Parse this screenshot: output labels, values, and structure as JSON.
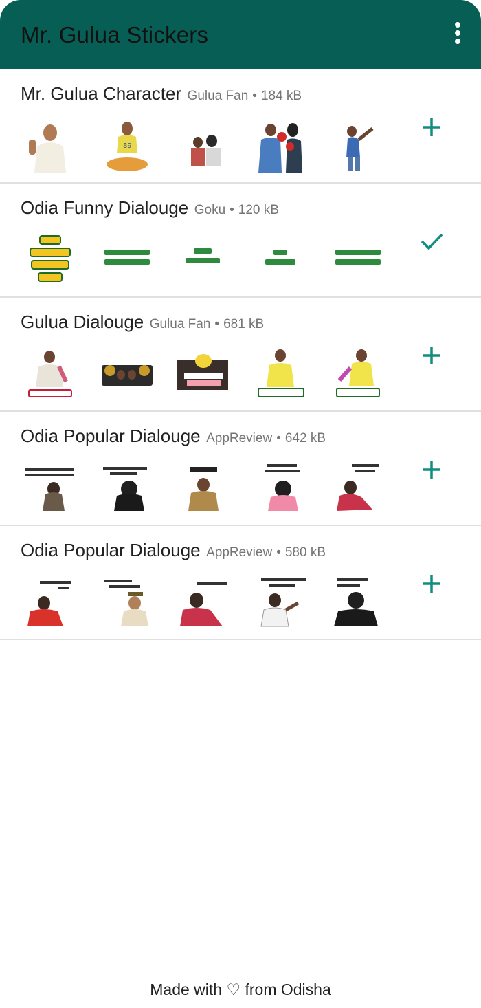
{
  "appbar": {
    "title": "Mr. Gulua Stickers",
    "menu_icon": "more-vert-icon"
  },
  "colors": {
    "appbar": "#075e54",
    "accent": "#128c7e",
    "divider": "#e0e0e0"
  },
  "packs": [
    {
      "name": "Mr. Gulua Character",
      "publisher": "Gulua Fan",
      "size": "184 kB",
      "action": "add",
      "action_icon": "plus-icon"
    },
    {
      "name": "Odia Funny Dialouge",
      "publisher": "Goku",
      "size": "120 kB",
      "action": "added",
      "action_icon": "check-icon"
    },
    {
      "name": "Gulua Dialouge",
      "publisher": "Gulua Fan",
      "size": "681 kB",
      "action": "add",
      "action_icon": "plus-icon"
    },
    {
      "name": "Odia Popular Dialouge",
      "publisher": "AppReview",
      "size": "642 kB",
      "action": "add",
      "action_icon": "plus-icon"
    },
    {
      "name": "Odia Popular Dialouge",
      "publisher": "AppReview",
      "size": "580 kB",
      "action": "add",
      "action_icon": "plus-icon"
    }
  ],
  "footer": {
    "text": "Made with ♡ from Odisha"
  }
}
